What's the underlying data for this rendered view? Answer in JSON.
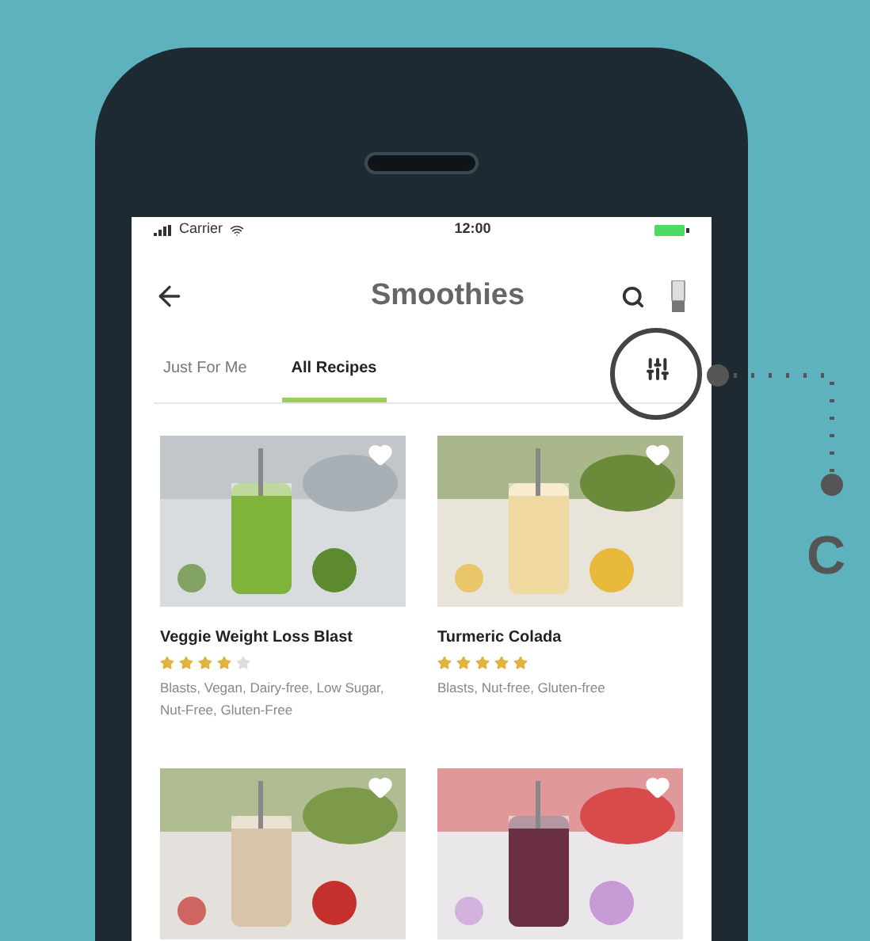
{
  "status_bar": {
    "carrier": "Carrier",
    "time": "12:00"
  },
  "header": {
    "title": "Smoothies"
  },
  "tabs": [
    {
      "label": "Just For Me",
      "selected": false
    },
    {
      "label": "All Recipes",
      "selected": true
    }
  ],
  "recipes": [
    {
      "kind": "picture",
      "name": "Veggie Weight Loss Blast",
      "stars": 4,
      "tags": "Blasts, Vegan, Dairy-free, Low Sugar, Nut-Free, Gluten-Free"
    },
    {
      "kind": "picture",
      "name": "Turmeric Colada",
      "stars": 5,
      "tags": "Blasts, Nut-free, Gluten-free"
    },
    {
      "kind": "picture"
    },
    {
      "kind": "picture"
    }
  ],
  "callout": {
    "label": "C"
  }
}
